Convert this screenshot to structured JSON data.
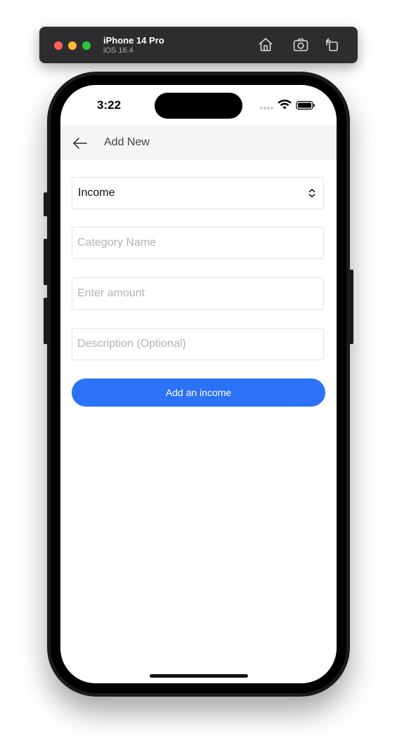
{
  "simulator": {
    "device_name": "iPhone 14 Pro",
    "os_version": "iOS 16.4",
    "buttons": [
      "home-icon",
      "screenshot-icon",
      "rotate-icon"
    ]
  },
  "status_bar": {
    "time": "3:22"
  },
  "nav": {
    "title": "Add New",
    "back_icon": "arrow-left-icon"
  },
  "form": {
    "type_select": {
      "value": "Income",
      "icon": "chevron-updown-icon"
    },
    "category_placeholder": "Category Name",
    "amount_placeholder": "Enter amount",
    "description_placeholder": "Description (Optional)",
    "submit_label": "Add an income"
  },
  "colors": {
    "accent": "#2b72f6",
    "nav_background": "#f5f5f5",
    "toolbar_background": "#2d2d2f"
  }
}
